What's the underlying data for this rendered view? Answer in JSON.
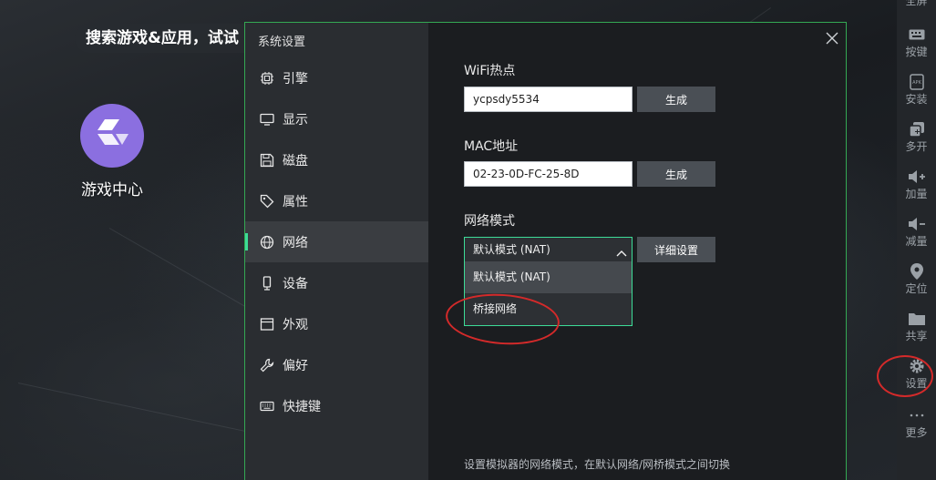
{
  "desktop": {
    "search_text": "搜索游戏&应用，试试",
    "app_label": "游戏中心",
    "app_icon": "game-center-icon",
    "app_color": "#8b6fe0"
  },
  "toolbar": {
    "items": [
      {
        "label": "全屏",
        "icon": "fullscreen-icon"
      },
      {
        "label": "按键",
        "icon": "keyboard-icon"
      },
      {
        "label": "安装",
        "icon": "apk-install-icon"
      },
      {
        "label": "多开",
        "icon": "multi-instance-icon"
      },
      {
        "label": "加量",
        "icon": "volume-up-icon"
      },
      {
        "label": "减量",
        "icon": "volume-down-icon"
      },
      {
        "label": "定位",
        "icon": "location-pin-icon"
      },
      {
        "label": "共享",
        "icon": "folder-icon"
      },
      {
        "label": "设置",
        "icon": "gear-icon"
      },
      {
        "label": "更多",
        "icon": "more-dots-icon"
      }
    ]
  },
  "dialog": {
    "title": "系统设置",
    "accent_color": "#3ddc97",
    "nav": [
      {
        "label": "引擎",
        "icon": "chip-icon"
      },
      {
        "label": "显示",
        "icon": "monitor-icon"
      },
      {
        "label": "磁盘",
        "icon": "disk-icon"
      },
      {
        "label": "属性",
        "icon": "tag-icon"
      },
      {
        "label": "网络",
        "icon": "globe-icon",
        "active": true
      },
      {
        "label": "设备",
        "icon": "phone-icon"
      },
      {
        "label": "外观",
        "icon": "window-icon"
      },
      {
        "label": "偏好",
        "icon": "wrench-icon"
      },
      {
        "label": "快捷键",
        "icon": "keyboard-icon"
      }
    ],
    "wifi": {
      "label": "WiFi热点",
      "value": "ycpsdy5534",
      "button": "生成"
    },
    "mac": {
      "label": "MAC地址",
      "value": "02-23-0D-FC-25-8D",
      "button": "生成"
    },
    "network_mode": {
      "label": "网络模式",
      "selected": "默认模式 (NAT)",
      "detail_button": "详细设置",
      "options": [
        "默认模式 (NAT)",
        "桥接网络"
      ]
    },
    "footer_note": "设置模拟器的网络模式，在默认网络/网桥模式之间切换"
  },
  "annotation_color": "#d42a2a"
}
